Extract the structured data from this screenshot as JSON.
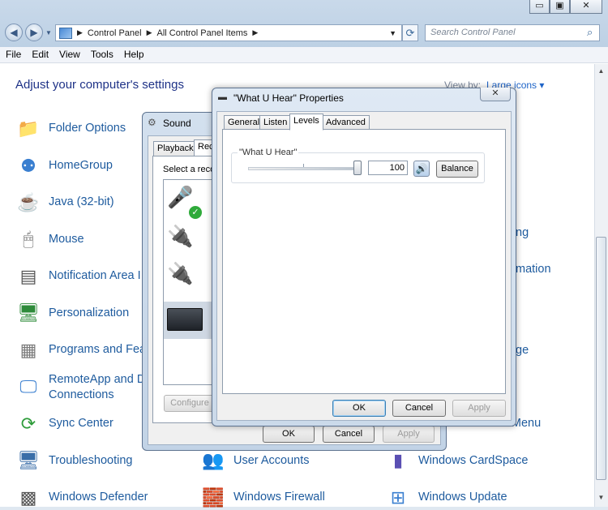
{
  "window": {
    "min_label": "▭",
    "max_label": "▣",
    "close_label": "✕"
  },
  "address": {
    "parts": [
      "Control Panel",
      "All Control Panel Items"
    ],
    "search_placeholder": "Search Control Panel"
  },
  "menu": [
    "File",
    "Edit",
    "View",
    "Tools",
    "Help"
  ],
  "page": {
    "title": "Adjust your computer's settings",
    "view_by_label": "View by:",
    "view_by_value": "Large icons ▾"
  },
  "items": [
    {
      "label": "Folder Options",
      "icon": "folder-options-icon"
    },
    {
      "label": "HomeGroup",
      "icon": "homegroup-icon"
    },
    {
      "label": "Java (32-bit)",
      "icon": "java-icon"
    },
    {
      "label": "Mouse",
      "icon": "mouse-icon"
    },
    {
      "label": "Notification Area I",
      "icon": "notification-area-icon"
    },
    {
      "label": "Personalization",
      "icon": "personalization-icon"
    },
    {
      "label": "Programs and Fea",
      "icon": "programs-features-icon"
    },
    {
      "label": "RemoteApp and D",
      "label2": "Connections",
      "icon": "remoteapp-icon"
    },
    {
      "label": "Sync Center",
      "icon": "sync-center-icon"
    },
    {
      "label": "Troubleshooting",
      "icon": "troubleshooting-icon"
    },
    {
      "label": "Windows Defender",
      "icon": "windows-defender-icon"
    }
  ],
  "col2_items": [
    {
      "label": "User Accounts",
      "icon": "user-accounts-icon"
    },
    {
      "label": "Windows Firewall",
      "icon": "windows-firewall-icon"
    }
  ],
  "col3_items": [
    {
      "label": "ng"
    },
    {
      "label": "mation"
    },
    {
      "label": "ge"
    },
    {
      "label": "and Start Menu"
    },
    {
      "label": "Windows CardSpace",
      "icon": "windows-cardspace-icon"
    },
    {
      "label": "Windows Update",
      "icon": "windows-update-icon"
    }
  ],
  "sound": {
    "title": "Sound",
    "tabs": [
      "Playback",
      "Rec"
    ],
    "instruction": "Select a reco",
    "configure_label": "Configure",
    "ok_label": "OK",
    "cancel_label": "Cancel",
    "apply_label": "Apply"
  },
  "props": {
    "title": "\"What U Hear\" Properties",
    "close_label": "✕",
    "tabs": [
      "General",
      "Listen",
      "Levels",
      "Advanced"
    ],
    "active_tab": "Levels",
    "group_label": "\"What U Hear\"",
    "level_value": "100",
    "balance_label": "Balance",
    "ok_label": "OK",
    "cancel_label": "Cancel",
    "apply_label": "Apply"
  }
}
